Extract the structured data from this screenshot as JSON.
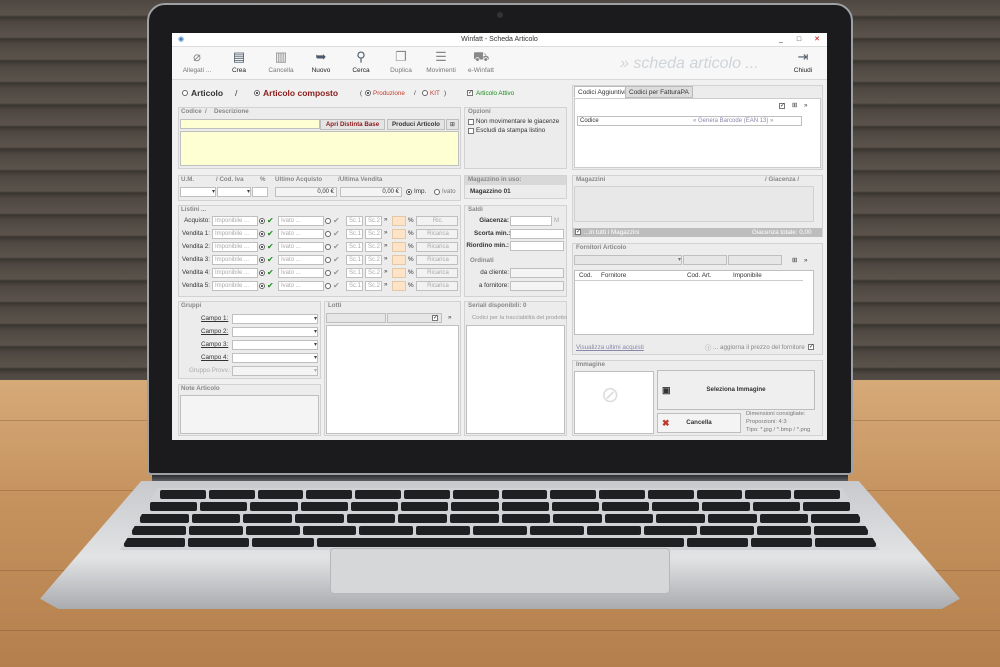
{
  "window": {
    "title": "Winfatt   -   Scheda Articolo",
    "min": "_",
    "max": "□",
    "close": "✕"
  },
  "toolbar": {
    "allegati": "Allegati ...",
    "crea": "Crea",
    "cancella": "Cancella",
    "nuovo": "Nuovo",
    "cerca": "Cerca",
    "duplica": "Duplica",
    "movimenti": "Movimenti",
    "ewinfatt": "e-Winfatt",
    "brand": "» scheda articolo ...",
    "chiudi": "Chiudi"
  },
  "type": {
    "articolo": "Articolo",
    "sep": "/",
    "composto": "Articolo composto",
    "produzione": "Produzione",
    "kit": "KIT",
    "attivo": "Articolo Attivo"
  },
  "codice": {
    "codice_label": "Codice",
    "desc_label": "Descrizione",
    "apri": "Apri Distinta Base",
    "produci": "Produci Articolo"
  },
  "opzioni": {
    "title": "Opzioni",
    "opt1": "Non movimentare le giacenze",
    "opt2": "Escludi da stampa listino"
  },
  "um": {
    "um": "U.M.",
    "iva": "/ Cod. Iva",
    "pct": "%",
    "ultimo_acq": "Ultimo Acquisto",
    "ultima_vend": "/Ultima Vendita",
    "acq_val": "0,00 €",
    "vend_val": "0,00 €",
    "imp": "Imp.",
    "ivato": "Ivato"
  },
  "magazzino": {
    "label": "Magazzino in uso:",
    "value": "Magazzino 01"
  },
  "saldi": {
    "title": "Saldi",
    "giacenza": "Giacenza:",
    "scorta": "Scorta min.:",
    "riordino": "Riordino min.:",
    "ordinati": "Ordinati",
    "da_cliente": "da cliente:",
    "a_fornitore": "a fornitore:"
  },
  "listini": {
    "title": "Listini ...",
    "rows": [
      {
        "label": "Acquisto:",
        "ric": "Ric."
      },
      {
        "label": "Vendita 1:",
        "ric": "Ricarica"
      },
      {
        "label": "Vendita 2:",
        "ric": "Ricarica"
      },
      {
        "label": "Vendita 3:",
        "ric": "Ricarica"
      },
      {
        "label": "Vendita 4:",
        "ric": "Ricarica"
      },
      {
        "label": "Vendita 5:",
        "ric": "Ricarica"
      }
    ],
    "imponibile": "Imponibile ...",
    "ivato": "Ivato ...",
    "sc1": "Sc.1",
    "sc2": "Sc.2",
    "sc": "Sc."
  },
  "gruppi": {
    "title": "Gruppi",
    "campo1": "Campo 1:",
    "campo2": "Campo 2:",
    "campo3": "Campo 3:",
    "campo4": "Campo 4:",
    "gruppo": "Gruppo Provv.:"
  },
  "lotti": {
    "title": "Lotti"
  },
  "seriali": {
    "title": "Seriali disponibili: 0",
    "hint": "Codici per la tracciabilità del prodotto"
  },
  "note": {
    "title": "Note Articolo"
  },
  "codici": {
    "tab1": "Codici Aggiuntivi",
    "tab2": "Codici per FatturaPA",
    "codice": "Codice",
    "genera": "« Genera Barcode (EAN 13) »"
  },
  "magazzini": {
    "title": "Magazzini",
    "giacenza": "/ Giacenza /",
    "in_tutti": "...in tutti i Magazzini",
    "totale": "Giacenza totale: 0,00"
  },
  "fornitori": {
    "title": "Fornitori Articolo",
    "cod": "Cod.",
    "fornitore": "Fornitore",
    "cod_art": "Cod. Art.",
    "imponibile": "Imponibile",
    "visualizza": "Visualizza ultimi acquisti",
    "aggiorna": "... aggiorna il prezzo del fornitore"
  },
  "immagine": {
    "title": "Immagine",
    "seleziona": "Seleziona Immagine",
    "cancella": "Cancella",
    "dim": "Dimensioni consigliate:",
    "prop": "Proporzioni: 4:3",
    "tipo": "Tipo: *.jpg / *.bmp / *.png"
  }
}
